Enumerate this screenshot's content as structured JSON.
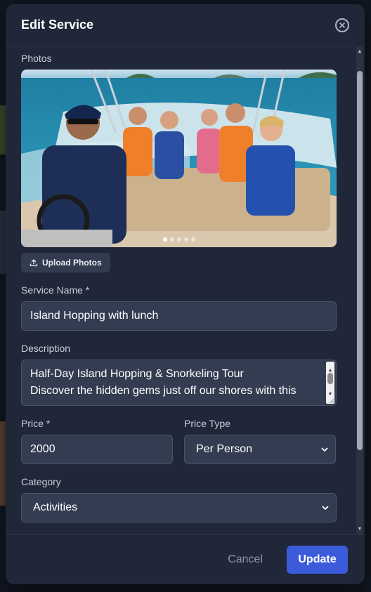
{
  "modal": {
    "title": "Edit Service"
  },
  "photos": {
    "label": "Photos",
    "dots_count": 5,
    "active_dot": 1,
    "upload_label": "Upload Photos"
  },
  "service_name": {
    "label": "Service Name *",
    "value": "Island Hopping with lunch"
  },
  "description": {
    "label": "Description",
    "lines": [
      "Half-Day Island Hopping & Snorkeling Tour",
      "Discover the hidden gems just off our shores with this"
    ]
  },
  "price": {
    "label": "Price *",
    "value": "2000"
  },
  "price_type": {
    "label": "Price Type",
    "selected": "Per Person"
  },
  "category": {
    "label": "Category",
    "selected": "Activities"
  },
  "footer": {
    "cancel_label": "Cancel",
    "update_label": "Update"
  },
  "colors": {
    "modal_bg": "#1f2738",
    "input_bg": "#333c50",
    "accent": "#3b5bdb"
  }
}
